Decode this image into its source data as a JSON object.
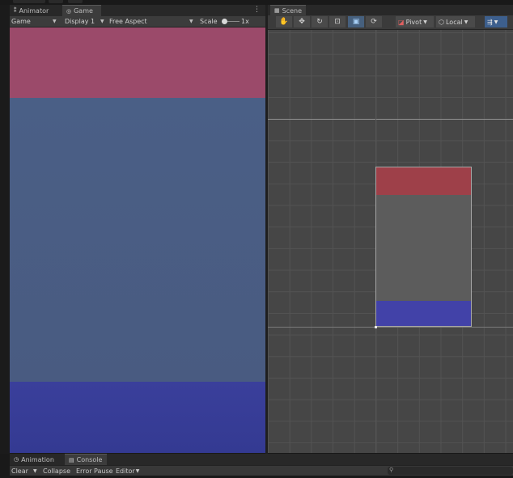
{
  "game_panel": {
    "tabs": [
      {
        "label": "Animator",
        "icon": "animator-icon"
      },
      {
        "label": "Game",
        "icon": "gamepad-icon"
      }
    ],
    "toolbar": {
      "display_mode": "Game",
      "display": "Display 1",
      "aspect": "Free Aspect",
      "scale_label": "Scale",
      "scale_value": "1x"
    },
    "view_colors": {
      "top": "#9b4a6a",
      "middle": "#4a5f86",
      "bottom": "#3a3f9b"
    }
  },
  "scene_panel": {
    "tab": {
      "label": "Scene",
      "icon": "scene-grid-icon"
    },
    "tools": [
      "hand-icon",
      "move-icon",
      "rotate-icon",
      "scale-icon",
      "rect-tool-icon",
      "transform-icon"
    ],
    "active_tool": "rect-tool-icon",
    "pivot_label": "Pivot",
    "space_label": "Local",
    "canvas_colors": {
      "top": "#9e4049",
      "middle": "#5c5c5c",
      "bottom": "#4242a8"
    }
  },
  "bottom_panel": {
    "tabs": [
      {
        "label": "Animation",
        "icon": "animation-icon"
      },
      {
        "label": "Console",
        "icon": "console-icon"
      }
    ],
    "toolbar": {
      "clear": "Clear",
      "collapse": "Collapse",
      "error_pause": "Error Pause",
      "editor": "Editor"
    }
  }
}
